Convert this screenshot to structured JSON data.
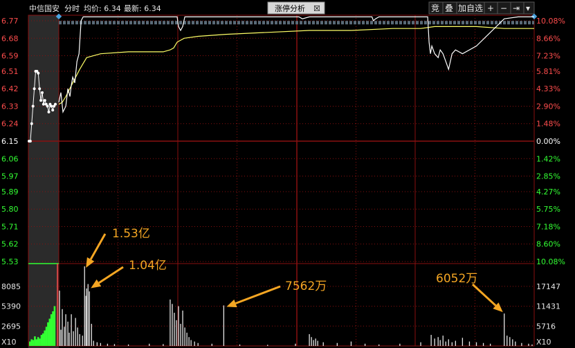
{
  "header": {
    "stock_name": "中信国安",
    "mode": "分时",
    "avg_label": "均价: 6.34",
    "last_label": "最新: 6.34",
    "tab_label": "涨停分析",
    "tab_close": "☒",
    "btn_auction": "竞",
    "btn_overlay": "叠",
    "btn_add_watch": "加自选",
    "btn_zoom_in": "+",
    "btn_zoom_out": "−",
    "btn_end": "⇥",
    "btn_menu": "▾"
  },
  "chart_data": {
    "type": "line",
    "price_axis": {
      "ticks": [
        "6.77",
        "6.68",
        "6.59",
        "6.51",
        "6.42",
        "6.33",
        "6.24",
        "6.15",
        "6.06",
        "5.97",
        "5.89",
        "5.80",
        "5.71",
        "5.62",
        "5.53"
      ],
      "ylim": [
        5.53,
        6.77
      ],
      "reference": 6.15
    },
    "pct_axis": {
      "ticks_up": [
        "10.08%",
        "8.66%",
        "7.23%",
        "5.81%",
        "4.33%",
        "2.90%",
        "1.48%"
      ],
      "zero": "0.00%",
      "ticks_down": [
        "1.42%",
        "2.85%",
        "4.27%",
        "5.75%",
        "7.18%",
        "8.60%",
        "10.08%"
      ]
    },
    "volume_axis": {
      "left_ticks": [
        "8085",
        "5390",
        "2695"
      ],
      "right_ticks": [
        "17147",
        "11431",
        "5716"
      ],
      "unit_left": "X10",
      "unit_right": "X10"
    },
    "pre_auction": {
      "price": [
        6.15,
        6.15,
        6.24,
        6.33,
        6.42,
        6.51,
        6.51,
        6.5,
        6.42,
        6.36,
        6.4,
        6.34,
        6.36,
        6.34,
        6.33,
        6.3,
        6.34,
        6.33,
        6.31,
        6.33,
        6.34
      ]
    },
    "price_series": {
      "name": "",
      "x": [
        0,
        3,
        6,
        10,
        13,
        16,
        18,
        20,
        23,
        26,
        29,
        32,
        35,
        38,
        40,
        42,
        60,
        90,
        120,
        150,
        170,
        172,
        175,
        178,
        181,
        200,
        230,
        240,
        260,
        290,
        320,
        345,
        350,
        360,
        400,
        420,
        440,
        450,
        452,
        455,
        460,
        480,
        520,
        530,
        532,
        534,
        536,
        540,
        545,
        548,
        552,
        556,
        560,
        565,
        570,
        580,
        600,
        640,
        660,
        680,
        683
      ],
      "y": [
        6.35,
        6.4,
        6.3,
        6.33,
        6.42,
        6.38,
        6.44,
        6.48,
        6.45,
        6.56,
        6.6,
        6.77,
        6.8,
        6.8,
        6.8,
        6.8,
        6.8,
        6.8,
        6.8,
        6.8,
        6.8,
        6.74,
        6.72,
        6.74,
        6.8,
        6.8,
        6.8,
        6.8,
        6.8,
        6.8,
        6.8,
        6.8,
        6.78,
        6.8,
        6.8,
        6.8,
        6.8,
        6.8,
        6.77,
        6.78,
        6.8,
        6.8,
        6.8,
        6.8,
        6.66,
        6.6,
        6.64,
        6.6,
        6.58,
        6.62,
        6.6,
        6.56,
        6.52,
        6.6,
        6.62,
        6.6,
        6.64,
        6.78,
        6.8,
        6.8,
        6.8
      ]
    },
    "avg_series": {
      "name": "",
      "x": [
        0,
        5,
        10,
        20,
        30,
        35,
        40,
        60,
        100,
        150,
        160,
        165,
        170,
        180,
        200,
        240,
        300,
        360,
        420,
        480,
        520,
        540,
        560,
        600,
        640,
        683
      ],
      "y": [
        6.34,
        6.35,
        6.38,
        6.45,
        6.52,
        6.55,
        6.58,
        6.6,
        6.61,
        6.61,
        6.62,
        6.63,
        6.66,
        6.68,
        6.69,
        6.7,
        6.71,
        6.72,
        6.72,
        6.73,
        6.73,
        6.74,
        6.74,
        6.74,
        6.73,
        6.73
      ]
    },
    "limit_up_band": {
      "price": 6.76,
      "start_x": 0,
      "end_x": 683
    },
    "volume_bars": [
      {
        "x": 1,
        "v": 7500
      },
      {
        "x": 3,
        "v": 2200
      },
      {
        "x": 5,
        "v": 5000
      },
      {
        "x": 8,
        "v": 2600
      },
      {
        "x": 10,
        "v": 4300
      },
      {
        "x": 13,
        "v": 3300
      },
      {
        "x": 15,
        "v": 1800
      },
      {
        "x": 18,
        "v": 4300
      },
      {
        "x": 21,
        "v": 2000
      },
      {
        "x": 24,
        "v": 3800
      },
      {
        "x": 27,
        "v": 2500
      },
      {
        "x": 30,
        "v": 1600
      },
      {
        "x": 34,
        "v": 1400
      },
      {
        "x": 37,
        "v": 11500
      },
      {
        "x": 39,
        "v": 6800
      },
      {
        "x": 40,
        "v": 7800
      },
      {
        "x": 42,
        "v": 8400
      },
      {
        "x": 44,
        "v": 7400
      },
      {
        "x": 47,
        "v": 3000
      },
      {
        "x": 50,
        "v": 700
      },
      {
        "x": 55,
        "v": 500
      },
      {
        "x": 60,
        "v": 400
      },
      {
        "x": 70,
        "v": 300
      },
      {
        "x": 80,
        "v": 250
      },
      {
        "x": 100,
        "v": 200
      },
      {
        "x": 130,
        "v": 300
      },
      {
        "x": 150,
        "v": 250
      },
      {
        "x": 160,
        "v": 6300
      },
      {
        "x": 163,
        "v": 5700
      },
      {
        "x": 166,
        "v": 4500
      },
      {
        "x": 169,
        "v": 3500
      },
      {
        "x": 172,
        "v": 5400
      },
      {
        "x": 175,
        "v": 3000
      },
      {
        "x": 178,
        "v": 4800
      },
      {
        "x": 181,
        "v": 2500
      },
      {
        "x": 184,
        "v": 1800
      },
      {
        "x": 187,
        "v": 1200
      },
      {
        "x": 190,
        "v": 800
      },
      {
        "x": 195,
        "v": 600
      },
      {
        "x": 200,
        "v": 400
      },
      {
        "x": 220,
        "v": 300
      },
      {
        "x": 237,
        "v": 5500
      },
      {
        "x": 260,
        "v": 200
      },
      {
        "x": 300,
        "v": 150
      },
      {
        "x": 340,
        "v": 300
      },
      {
        "x": 360,
        "v": 1600
      },
      {
        "x": 363,
        "v": 1200
      },
      {
        "x": 366,
        "v": 800
      },
      {
        "x": 369,
        "v": 1000
      },
      {
        "x": 372,
        "v": 700
      },
      {
        "x": 380,
        "v": 500
      },
      {
        "x": 400,
        "v": 400
      },
      {
        "x": 420,
        "v": 600
      },
      {
        "x": 440,
        "v": 300
      },
      {
        "x": 460,
        "v": 200
      },
      {
        "x": 490,
        "v": 300
      },
      {
        "x": 520,
        "v": 500
      },
      {
        "x": 535,
        "v": 1500
      },
      {
        "x": 540,
        "v": 1000
      },
      {
        "x": 545,
        "v": 1200
      },
      {
        "x": 548,
        "v": 800
      },
      {
        "x": 552,
        "v": 1400
      },
      {
        "x": 556,
        "v": 600
      },
      {
        "x": 560,
        "v": 900
      },
      {
        "x": 565,
        "v": 500
      },
      {
        "x": 570,
        "v": 700
      },
      {
        "x": 580,
        "v": 1100
      },
      {
        "x": 590,
        "v": 600
      },
      {
        "x": 600,
        "v": 500
      },
      {
        "x": 610,
        "v": 400
      },
      {
        "x": 620,
        "v": 300
      },
      {
        "x": 640,
        "v": 4400
      },
      {
        "x": 644,
        "v": 1400
      },
      {
        "x": 648,
        "v": 1200
      },
      {
        "x": 652,
        "v": 900
      },
      {
        "x": 656,
        "v": 600
      },
      {
        "x": 665,
        "v": 400
      },
      {
        "x": 675,
        "v": 300
      },
      {
        "x": 680,
        "v": 200
      }
    ],
    "pre_volume": [
      {
        "x": 0,
        "v": 600
      },
      {
        "x": 5,
        "v": 900
      },
      {
        "x": 10,
        "v": 800
      },
      {
        "x": 15,
        "v": 1300
      },
      {
        "x": 20,
        "v": 900
      },
      {
        "x": 25,
        "v": 1200
      },
      {
        "x": 30,
        "v": 1000
      },
      {
        "x": 35,
        "v": 1500
      },
      {
        "x": 40,
        "v": 1700
      },
      {
        "x": 45,
        "v": 2100
      },
      {
        "x": 50,
        "v": 2600
      },
      {
        "x": 55,
        "v": 3200
      },
      {
        "x": 60,
        "v": 3700
      },
      {
        "x": 65,
        "v": 4300
      },
      {
        "x": 70,
        "v": 4700
      },
      {
        "x": 75,
        "v": 5400
      }
    ],
    "volume_ylim": [
      0,
      10800
    ],
    "annotations": [
      {
        "text": "1.53亿",
        "bar_x": 37,
        "bar_v": 11500
      },
      {
        "text": "1.04亿",
        "bar_x": 42,
        "bar_v": 8400
      },
      {
        "text": "7562万",
        "bar_x": 237,
        "bar_v": 5500
      },
      {
        "text": "6052万",
        "bar_x": 640,
        "bar_v": 4400
      }
    ]
  },
  "colors": {
    "up": "#ff4d4d",
    "down": "#33ff33",
    "grid": "#8a1010",
    "price_line": "#ffffff",
    "avg_line": "#ffff66",
    "annotation": "#f5a623",
    "band": "#5a6b78"
  }
}
